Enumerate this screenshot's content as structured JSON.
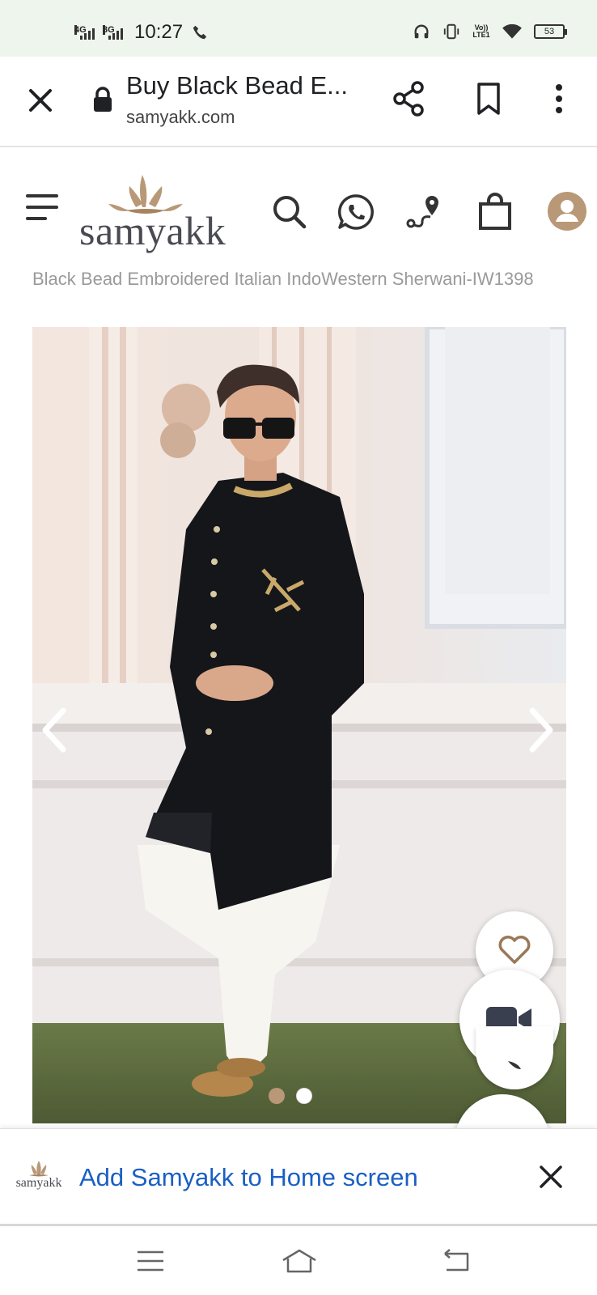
{
  "status_bar": {
    "sim1": "4G",
    "sim2": "3G",
    "time": "10:27",
    "volte": "Vo)) LTE1",
    "battery": "53"
  },
  "browser": {
    "page_title": "Buy Black Bead E...",
    "url": "samyakk.com"
  },
  "site": {
    "logo_text": "samyakk"
  },
  "product": {
    "title": "Black Bead Embroidered Italian IndoWestern Sherwani-IW1398"
  },
  "banner": {
    "logo_text": "samyakk",
    "message": "Add Samyakk to Home screen"
  },
  "icons": {
    "close": "close-icon",
    "lock": "lock-icon",
    "share": "share-icon",
    "bookmark": "bookmark-icon",
    "more": "more-vert-icon",
    "menu": "hamburger-icon",
    "search": "search-icon",
    "whatsapp": "whatsapp-icon",
    "location": "route-location-icon",
    "bag": "shopping-bag-icon",
    "user": "user-account-icon",
    "wishlist": "heart-icon",
    "video": "video-camera-icon"
  },
  "colors": {
    "brand_gold": "#b89877",
    "link_blue": "#1a5fc4",
    "status_bg": "#eef5ec"
  }
}
